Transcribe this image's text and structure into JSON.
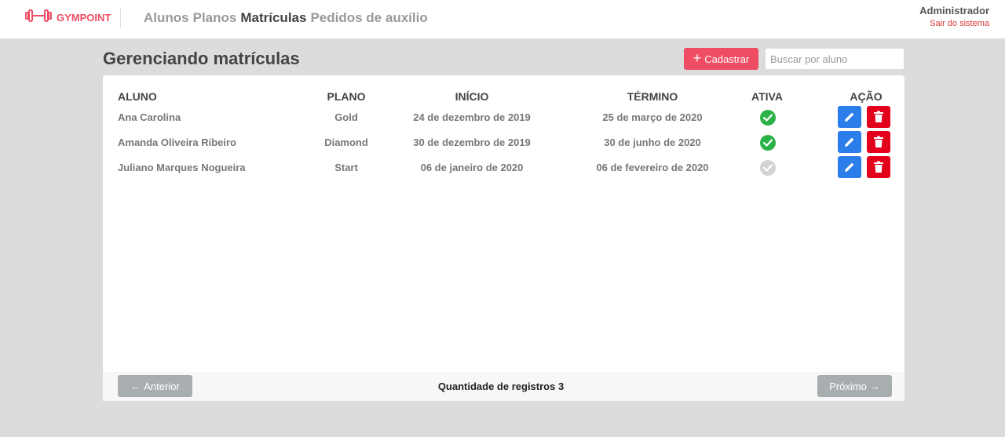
{
  "brand": {
    "name": "GYMPOINT",
    "icon": "dumbbell-icon",
    "color": "#ee4d64"
  },
  "nav": [
    {
      "label": "Alunos",
      "active": false
    },
    {
      "label": "Planos",
      "active": false
    },
    {
      "label": "Matrículas",
      "active": true
    },
    {
      "label": "Pedidos de auxílio",
      "active": false
    }
  ],
  "user": {
    "name": "Administrador",
    "logout": "Sair do sistema"
  },
  "page": {
    "title": "Gerenciando matrículas"
  },
  "toolbar": {
    "add_label": "Cadastrar",
    "search_placeholder": "Buscar por aluno",
    "search_value": ""
  },
  "table": {
    "headers": {
      "student": "ALUNO",
      "plan": "PLANO",
      "start": "INÍCIO",
      "end": "TÉRMINO",
      "active": "ATIVA",
      "action": "AÇÃO"
    },
    "rows": [
      {
        "student": "Ana Carolina",
        "plan": "Gold",
        "start": "24 de dezembro de 2019",
        "end": "25 de março de 2020",
        "active": true
      },
      {
        "student": "Amanda Oliveira Ribeiro",
        "plan": "Diamond",
        "start": "30 de dezembro de 2019",
        "end": "30 de junho de 2020",
        "active": true
      },
      {
        "student": "Juliano Marques Nogueira",
        "plan": "Start",
        "start": "06 de janeiro de 2020",
        "end": "06 de fevereiro de 2020",
        "active": false
      }
    ]
  },
  "footer": {
    "prev_label": "Anterior",
    "next_label": "Próximo",
    "count_text": "Quantidade de registros 3"
  },
  "colors": {
    "accent": "#ee4d64",
    "active": "#2bb34a",
    "inactive": "#d3d3d3",
    "edit": "#2b7de9",
    "delete": "#e3001b"
  }
}
